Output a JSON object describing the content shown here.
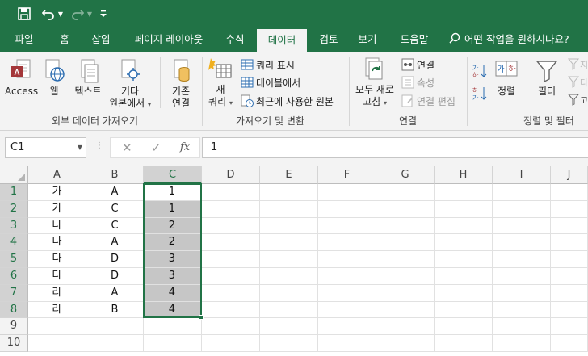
{
  "quick_access": {
    "save_icon": "save-icon",
    "undo_icon": "undo-icon",
    "redo_icon": "redo-icon",
    "customize_icon": "customize-qat-icon"
  },
  "tabs": [
    {
      "label": "파일"
    },
    {
      "label": "홈"
    },
    {
      "label": "삽입"
    },
    {
      "label": "페이지 레이아웃"
    },
    {
      "label": "수식"
    },
    {
      "label": "데이터"
    },
    {
      "label": "검토"
    },
    {
      "label": "보기"
    },
    {
      "label": "도움말"
    }
  ],
  "tell_me": "어떤 작업을 원하시나요?",
  "ribbon": {
    "get_external": {
      "access": "Access",
      "web": "웹",
      "text": "텍스트",
      "other_line1": "기타",
      "other_line2": "원본에서",
      "existing_line1": "기존",
      "existing_line2": "연결",
      "label": "외부 데이터 가져오기"
    },
    "get_transform": {
      "new_query_line1": "새",
      "new_query_line2": "쿼리",
      "show_queries": "쿼리 표시",
      "from_table": "테이블에서",
      "recent_sources": "최근에 사용한 원본",
      "label": "가져오기 및 변환"
    },
    "connections": {
      "refresh_line1": "모두 새로",
      "refresh_line2": "고침",
      "connections": "연결",
      "properties": "속성",
      "edit_links": "연결 편집",
      "label": "연결"
    },
    "sort_filter": {
      "sort": "정렬",
      "filter": "필터",
      "label": "정렬 및 필터"
    }
  },
  "formula_bar": {
    "name_box": "C1",
    "fx": "fx",
    "value": "1"
  },
  "sheet": {
    "columns": [
      "A",
      "B",
      "C",
      "D",
      "E",
      "F",
      "G",
      "H",
      "I",
      "J"
    ],
    "rows": [
      "1",
      "2",
      "3",
      "4",
      "5",
      "6",
      "7",
      "8",
      "9",
      "10"
    ],
    "data": [
      [
        "가",
        "A",
        "1"
      ],
      [
        "가",
        "C",
        "1"
      ],
      [
        "나",
        "C",
        "2"
      ],
      [
        "다",
        "A",
        "2"
      ],
      [
        "다",
        "D",
        "3"
      ],
      [
        "다",
        "D",
        "3"
      ],
      [
        "라",
        "A",
        "4"
      ],
      [
        "라",
        "B",
        "4"
      ]
    ]
  },
  "colors": {
    "excel_green": "#217346",
    "selection_fill": "#c6c6c6"
  }
}
